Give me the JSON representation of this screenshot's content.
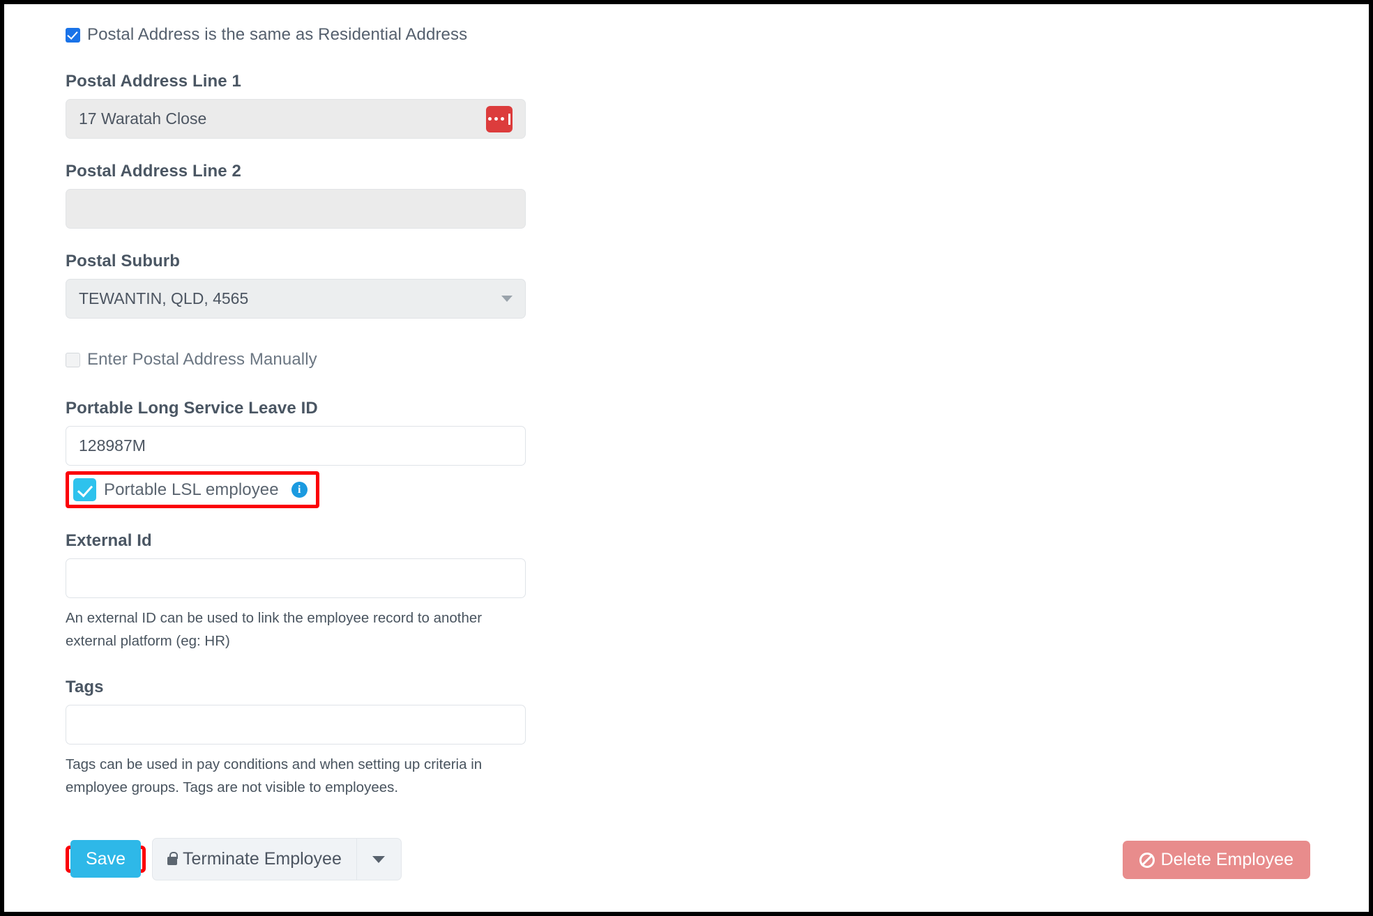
{
  "form": {
    "same_address_checkbox": {
      "label": "Postal Address is the same as Residential Address",
      "checked": true
    },
    "postal_address_line_1": {
      "label": "Postal Address Line 1",
      "value": "17 Waratah Close",
      "disabled": true,
      "action_icon": "ellipsis-cursor-icon"
    },
    "postal_address_line_2": {
      "label": "Postal Address Line 2",
      "value": "",
      "disabled": true
    },
    "postal_suburb": {
      "label": "Postal Suburb",
      "value": "TEWANTIN, QLD, 4565",
      "disabled": true
    },
    "manual_address_checkbox": {
      "label": "Enter Postal Address Manually",
      "checked": false
    },
    "portable_lsl_id": {
      "label": "Portable Long Service Leave ID",
      "value": "128987M"
    },
    "portable_lsl_employee": {
      "label": "Portable LSL employee",
      "checked": true,
      "info_glyph": "i",
      "highlighted": true
    },
    "external_id": {
      "label": "External Id",
      "value": "",
      "help": "An external ID can be used to link the employee record to another external platform (eg: HR)"
    },
    "tags": {
      "label": "Tags",
      "value": "",
      "help": "Tags can be used in pay conditions and when setting up criteria in employee groups. Tags are not visible to employees."
    }
  },
  "footer": {
    "save_label": "Save",
    "terminate_label": "Terminate Employee",
    "delete_label": "Delete Employee"
  },
  "colors": {
    "accent_blue": "#2eb8e8",
    "checkbox_blue": "#1a73e8",
    "highlight_red": "#fb0007",
    "delete_pink": "#e88c8c",
    "badge_red": "#dc3c3c",
    "info_blue": "#1b9ae0",
    "label_gray": "#4a5663"
  }
}
